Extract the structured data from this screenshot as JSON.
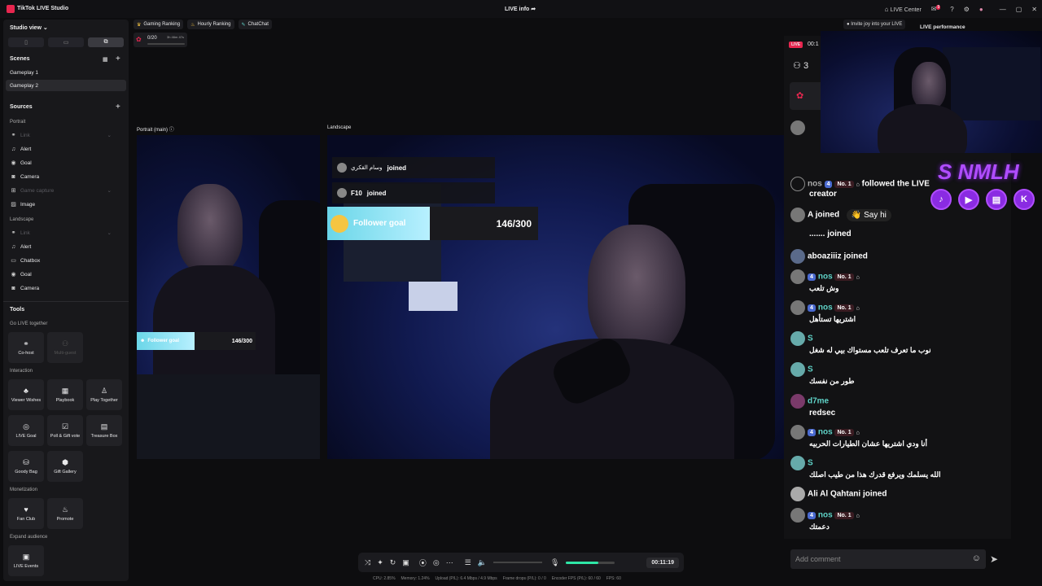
{
  "titlebar": {
    "app": "TikTok LIVE Studio",
    "center": "LIVE info",
    "live_center": "LIVE Center",
    "notif_count": "9"
  },
  "sidebar": {
    "studio_view": "Studio view",
    "scenes_title": "Scenes",
    "scenes": [
      "Gameplay 1",
      "Gameplay 2"
    ],
    "sources_title": "Sources",
    "portrait_title": "Portrait",
    "portrait_items": [
      {
        "icon": "link",
        "label": "Link",
        "dim": true
      },
      {
        "icon": "bell",
        "label": "Alert"
      },
      {
        "icon": "goal",
        "label": "Goal"
      },
      {
        "icon": "camera",
        "label": "Camera"
      },
      {
        "icon": "gamepad",
        "label": "Game capture",
        "dim": true
      },
      {
        "icon": "image",
        "label": "Image"
      }
    ],
    "landscape_title": "Landscape",
    "landscape_items": [
      {
        "icon": "link",
        "label": "Link",
        "dim": true
      },
      {
        "icon": "bell",
        "label": "Alert"
      },
      {
        "icon": "chat",
        "label": "Chatbox"
      },
      {
        "icon": "goal",
        "label": "Goal"
      },
      {
        "icon": "camera",
        "label": "Camera"
      }
    ],
    "tools_title": "Tools",
    "go_live_together": "Go LIVE together",
    "cohost": "Co-host",
    "multiguest": "Multi-guest",
    "interaction": "Interaction",
    "interaction_tools": [
      "Viewer Wishes",
      "Playbook",
      "Play Together",
      "LIVE Goal",
      "Poll & Gift vote",
      "Treasure Box",
      "Goody Bag",
      "Gift Gallery"
    ],
    "monetization": "Monetization",
    "monetization_tools": [
      "Fan Club",
      "Promote"
    ],
    "expand": "Expand audience",
    "expand_tools": [
      "LIVE Events"
    ]
  },
  "chips": [
    "Gaming Ranking",
    "Hourly Ranking",
    "ChatChat"
  ],
  "goal_mini": {
    "count": "0/20",
    "time": "3h 46m 47s"
  },
  "preview": {
    "portrait_label": "Portrait (main)",
    "landscape_label": "Landscape"
  },
  "overlay": {
    "join1_name": "وسام القكري",
    "join1": "joined",
    "join2_name": "F10",
    "join2": "joined",
    "goal_label": "Follower goal",
    "goal_value": "146/300"
  },
  "topright": {
    "invite": "Invite joy into your LIVE",
    "live_perf": "LIVE performance",
    "live_badge": "LIVE",
    "timer": "00:1",
    "viewers": "3",
    "streamer_tag": "S NMLH"
  },
  "chat": {
    "r0_name": "nos",
    "r0_lvl": "4",
    "r0_rank": "No. 1",
    "r0_text": "followed the LIVE",
    "r0_sub": "creator",
    "r1_name": "A",
    "r1_text": "joined",
    "r1_sayhi": "Say hi",
    "r2_text": "....... joined",
    "r3_name": "aboaziiiz",
    "r3_text": "joined",
    "r4_name": "nos",
    "r4_lvl": "4",
    "r4_rank": "No. 1",
    "r4_text": "وش تلعب",
    "r5_name": "nos",
    "r5_lvl": "4",
    "r5_rank": "No. 1",
    "r5_text": "اشتريها تستأهل",
    "r6_name": "S",
    "r6_text": "نوب ما تعرف تلعب مستواك بيي له شغل",
    "r7_name": "S",
    "r7_text": "طور من نفسك",
    "r8_name": "d7me",
    "r8_text": "redsec",
    "r9_name": "nos",
    "r9_lvl": "4",
    "r9_rank": "No. 1",
    "r9_text": "أنا ودي اشتريها عشان الطيارات الحربيه",
    "r10_name": "S",
    "r10_text": "الله يسلمك ويرفع قدرك هذا من طيب اصلك",
    "r11_name": "Ali Al Qahtani",
    "r11_text": "joined",
    "r12_name": "nos",
    "r12_lvl": "4",
    "r12_rank": "No. 1",
    "r12_text": "دعمتك",
    "input_placeholder": "Add comment"
  },
  "controls": {
    "time": "00:11:19"
  },
  "status": {
    "cpu": "CPU: 2.85%",
    "memory": "Memory: 1.24%",
    "upload": "Upload (P/L): 6.4 Mbps / 4.9 Mbps",
    "drops": "Frame drops (P/L): 0 / 0",
    "encoder": "Encoder FPS (P/L): 60 / 60",
    "fps": "FPS: 60"
  },
  "colors": {
    "accent": "#e8264f",
    "goal": "#6ad6e8",
    "level": "#4a6ad0",
    "social": "#8a2be2"
  }
}
